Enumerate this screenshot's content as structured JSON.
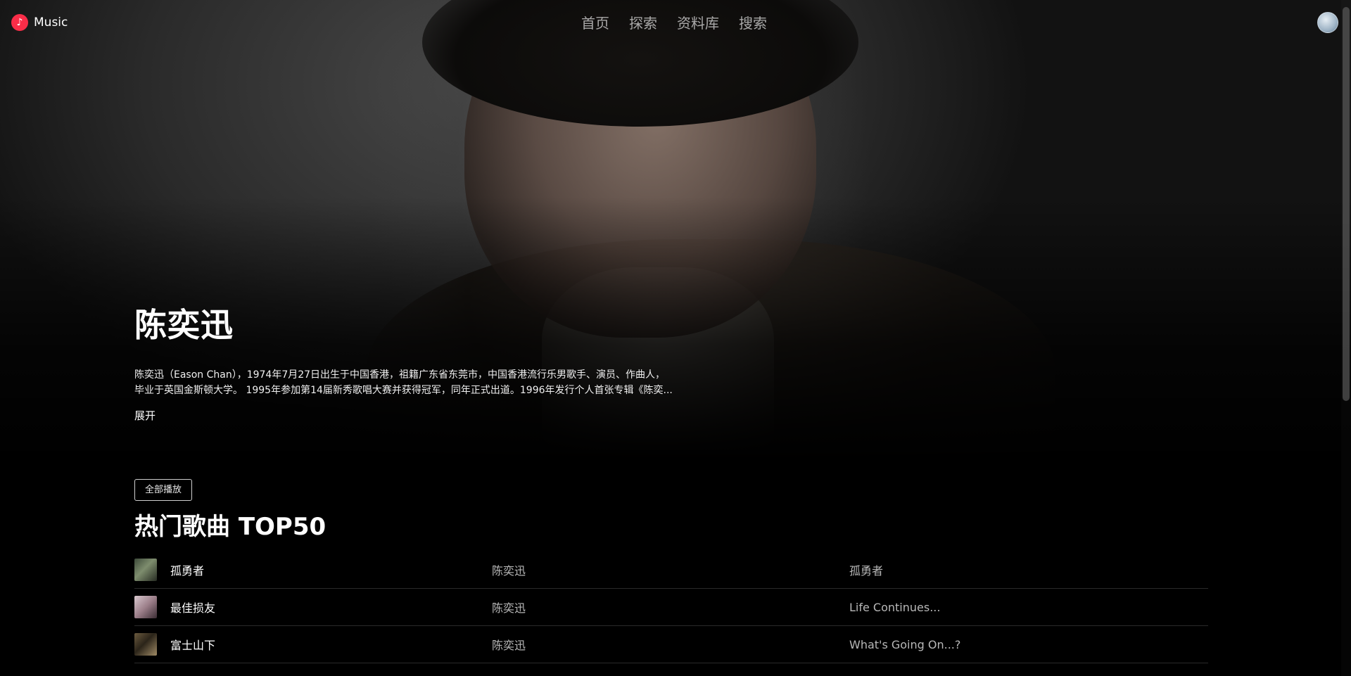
{
  "app": {
    "name": "Music"
  },
  "nav": [
    {
      "label": "首页"
    },
    {
      "label": "探索"
    },
    {
      "label": "资料库"
    },
    {
      "label": "搜索"
    }
  ],
  "artist": {
    "name": "陈奕迅",
    "bio_line1": "陈奕迅（Eason Chan），1974年7月27日出生于中国香港，祖籍广东省东莞市，中国香港流行乐男歌手、演员、作曲人，",
    "bio_line2": "毕业于英国金斯顿大学。 1995年参加第14届新秀歌唱大赛并获得冠军，同年正式出道。1996年发行个人首张专辑《陈奕...",
    "expand_label": "展开"
  },
  "songs_section": {
    "play_all_label": "全部播放",
    "title": "热门歌曲 TOP50",
    "songs": [
      {
        "title": "孤勇者",
        "artist": "陈奕迅",
        "album": "孤勇者"
      },
      {
        "title": "最佳损友",
        "artist": "陈奕迅",
        "album": "Life Continues..."
      },
      {
        "title": "富士山下",
        "artist": "陈奕迅",
        "album": "What's Going On...?"
      }
    ]
  },
  "icons": {
    "logo": "music-note-icon",
    "avatar": "user-avatar"
  },
  "colors": {
    "brand": "#fa2d48",
    "background": "#000000"
  }
}
